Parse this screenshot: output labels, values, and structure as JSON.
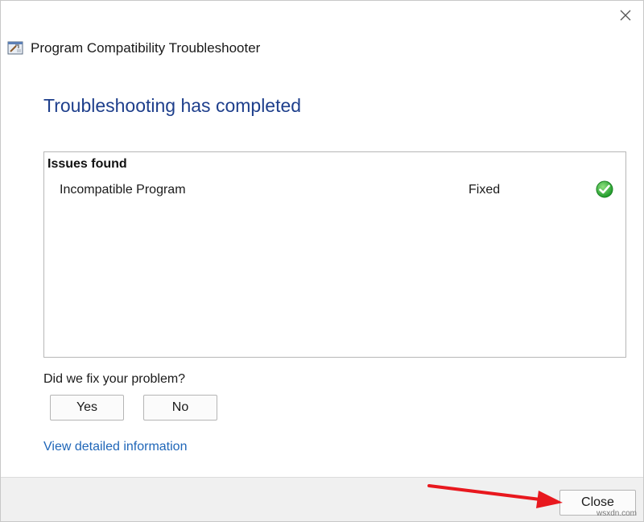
{
  "window": {
    "title": "Program Compatibility Troubleshooter",
    "icons": {
      "close": "close-icon",
      "app": "troubleshooter-app-icon"
    }
  },
  "main": {
    "heading": "Troubleshooting has completed",
    "issues": {
      "header": "Issues found",
      "rows": [
        {
          "name": "Incompatible Program",
          "status": "Fixed",
          "status_icon": "green-check-icon"
        }
      ]
    },
    "question": "Did we fix your problem?",
    "yes_label": "Yes",
    "no_label": "No",
    "detail_link": "View detailed information"
  },
  "footer": {
    "close_label": "Close"
  },
  "annotation": {
    "arrow_color": "#e8181e"
  },
  "watermark": "wsxdn.com",
  "colors": {
    "heading": "#1e3f8c",
    "link": "#1f66b8",
    "footer_bg": "#f0f0f0",
    "check_green": "#22a52b"
  }
}
